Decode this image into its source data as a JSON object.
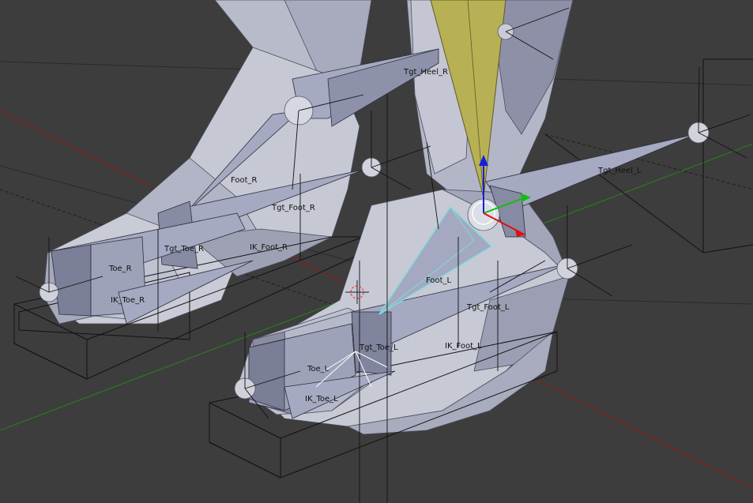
{
  "viewport": {
    "colors": {
      "background": "#3d3d3d",
      "mesh_light": "#c3c5d2",
      "mesh_mid": "#9fa2b6",
      "mesh_dark": "#7f8296",
      "bone_fill": "#a4a8c0",
      "bone_selected_outline": "#7fdede",
      "bone_active": "#b8b055",
      "x_axis": "#8b1c1c",
      "y_axis": "#2a7a1e",
      "gizmo_x": "#e01010",
      "gizmo_y": "#10c010",
      "gizmo_z": "#1020e0"
    },
    "bones": [
      {
        "id": "tgt-heel-r",
        "label": "Tgt_Heel_R"
      },
      {
        "id": "foot-r",
        "label": "Foot_R"
      },
      {
        "id": "tgt-foot-r",
        "label": "Tgt_Foot_R"
      },
      {
        "id": "tgt-toe-r",
        "label": "Tgt_Toe_R"
      },
      {
        "id": "ik-foot-r",
        "label": "IK_Foot_R"
      },
      {
        "id": "toe-r",
        "label": "Toe_R"
      },
      {
        "id": "ik-toe-r",
        "label": "IK_Toe_R"
      },
      {
        "id": "tgt-heel-l",
        "label": "Tgt_Heel_L"
      },
      {
        "id": "foot-l",
        "label": "Foot_L"
      },
      {
        "id": "tgt-foot-l",
        "label": "Tgt_Foot_L"
      },
      {
        "id": "tgt-toe-l",
        "label": "Tgt_Toe_L"
      },
      {
        "id": "ik-foot-l",
        "label": "IK_Foot_L"
      },
      {
        "id": "toe-l",
        "label": "Toe_L"
      },
      {
        "id": "ik-toe-l",
        "label": "IK_Toe_L"
      }
    ]
  }
}
